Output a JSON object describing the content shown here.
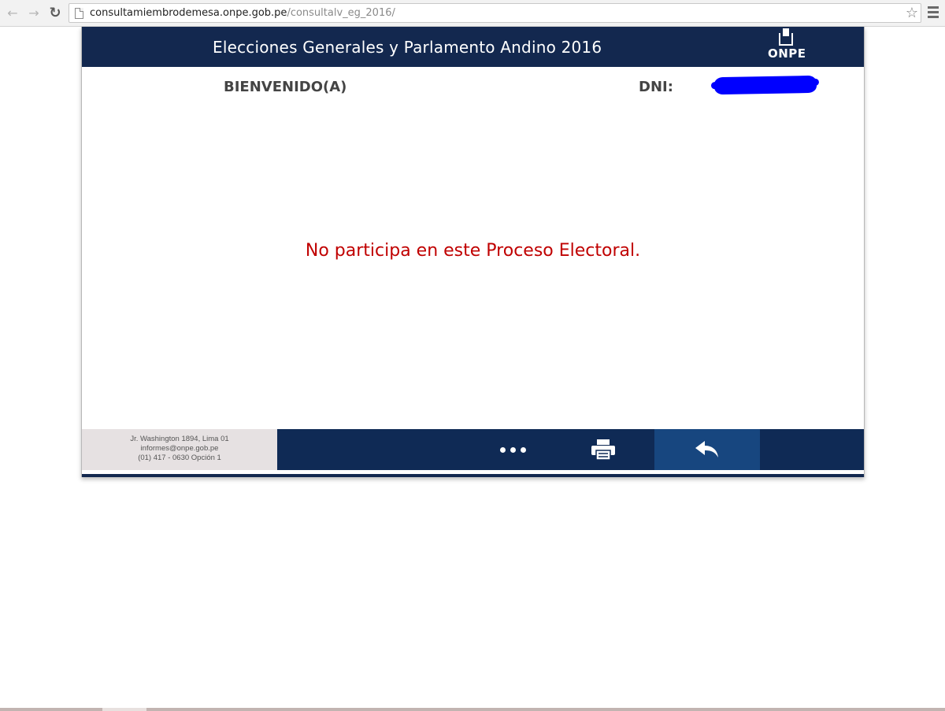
{
  "browser": {
    "url_host": "consultamiembrodemesa.onpe.gob.pe",
    "url_path": "/consultalv_eg_2016/"
  },
  "header": {
    "title": "Elecciones Generales y Parlamento Andino 2016",
    "logo_text": "ONPE"
  },
  "welcome": {
    "greeting": "BIENVENIDO(A)",
    "dni_label": "DNI:"
  },
  "message": "No participa en este Proceso Electoral.",
  "footer": {
    "address": "Jr. Washington 1894, Lima 01",
    "email": "informes@onpe.gob.pe",
    "phone": "(01) 417 - 0630 Opción 1"
  },
  "icons": {
    "more": "more-dots-icon",
    "print": "printer-icon",
    "back": "reply-back-icon"
  },
  "colors": {
    "header_bg": "#13284f",
    "message": "#c00000",
    "back_button_bg": "#17467f"
  }
}
